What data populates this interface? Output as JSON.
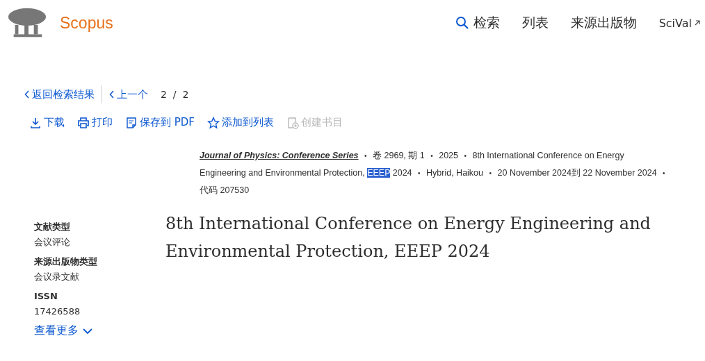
{
  "header": {
    "brand": "Scopus",
    "nav": [
      {
        "label": "检索",
        "kind": "search"
      },
      {
        "label": "列表",
        "kind": "plain"
      },
      {
        "label": "来源出版物",
        "kind": "plain"
      },
      {
        "label": "SciVal",
        "kind": "external"
      }
    ]
  },
  "pager": {
    "back": "返回检索结果",
    "previous": "上一个",
    "position": "2  /  2"
  },
  "actions": [
    {
      "label": "下载",
      "kind": "download",
      "disabled": false
    },
    {
      "label": "打印",
      "kind": "print",
      "disabled": false
    },
    {
      "label": "保存到 PDF",
      "kind": "pdf",
      "disabled": false
    },
    {
      "label": "添加到列表",
      "kind": "star",
      "disabled": false
    },
    {
      "label": "创建书目",
      "kind": "bib",
      "disabled": true
    }
  ],
  "source": [
    {
      "kind": "journal",
      "text": "Journal of Physics: Conference Series"
    },
    {
      "kind": "sep",
      "text": "•"
    },
    {
      "kind": "text",
      "text": "卷 2969, 期 1"
    },
    {
      "kind": "sep",
      "text": "•"
    },
    {
      "kind": "text",
      "text": "2025"
    },
    {
      "kind": "sep",
      "text": "•"
    },
    {
      "kind": "text",
      "text": "8th International Conference on Energy"
    },
    {
      "kind": "text",
      "text": "Engineering and Environmental Protection,"
    },
    {
      "kind": "highlight",
      "text": "EEEP"
    },
    {
      "kind": "text",
      "text": "2024"
    },
    {
      "kind": "sep",
      "text": "•"
    },
    {
      "kind": "text",
      "text": "Hybrid, Haikou"
    },
    {
      "kind": "sep",
      "text": "•"
    },
    {
      "kind": "text",
      "text": "20 November 2024到 22 November 2024"
    },
    {
      "kind": "sep",
      "text": "•"
    },
    {
      "kind": "text",
      "text": "代码 207530"
    }
  ],
  "details": [
    {
      "label": "文献类型",
      "value": "会议评论"
    },
    {
      "label": "来源出版物类型",
      "value": "会议录文献"
    },
    {
      "label": "ISSN",
      "value": "17426588"
    }
  ],
  "more": "查看更多",
  "title": "8th International Conference on Energy Engineering and Environmental Protection, EEEP 2024"
}
